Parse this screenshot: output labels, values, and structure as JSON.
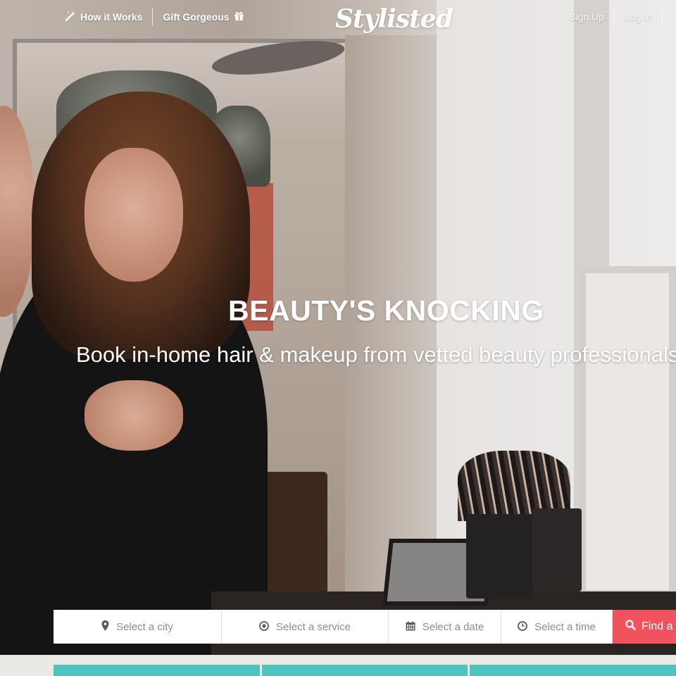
{
  "nav": {
    "how_it_works": "How it Works",
    "gift": "Gift Gorgeous",
    "logo": "Stylisted",
    "sign_up": "Sign Up",
    "log_in": "Log In",
    "icons": {
      "how_it_works": "magic-wand-icon",
      "gift": "gift-icon"
    }
  },
  "hero": {
    "headline": "BEAUTY'S KNOCKING",
    "subline": "Book in-home hair & makeup from vetted beauty professionals"
  },
  "search": {
    "city": "Select a city",
    "service": "Select a service",
    "date": "Select a date",
    "time": "Select a time",
    "find": "Find a",
    "icons": {
      "city": "map-pin-icon",
      "service": "target-icon",
      "date": "calendar-icon",
      "time": "clock-icon",
      "find": "search-icon"
    }
  },
  "colors": {
    "accent": "#f0525e",
    "teal": "#4dc4c2",
    "text_on_hero": "#ffffff"
  }
}
